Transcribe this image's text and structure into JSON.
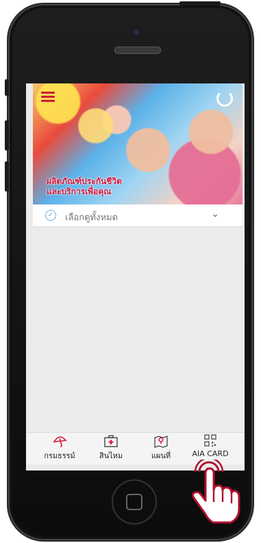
{
  "banner": {
    "caption_line1": "ผลิตภัณฑ์ประกันชีวิต",
    "caption_line2": "และบริการเพื่อคุณ"
  },
  "filter": {
    "label": "เลือกดูทั้งหมด"
  },
  "tabs": [
    {
      "label": "กรมธรรม์",
      "icon": "umbrella-icon"
    },
    {
      "label": "สินไหม",
      "icon": "medical-kit-icon"
    },
    {
      "label": "แผนที่",
      "icon": "map-pin-icon"
    },
    {
      "label": "AIA CARD",
      "icon": "qr-code-icon"
    }
  ],
  "colors": {
    "brand_red": "#d3153a"
  }
}
